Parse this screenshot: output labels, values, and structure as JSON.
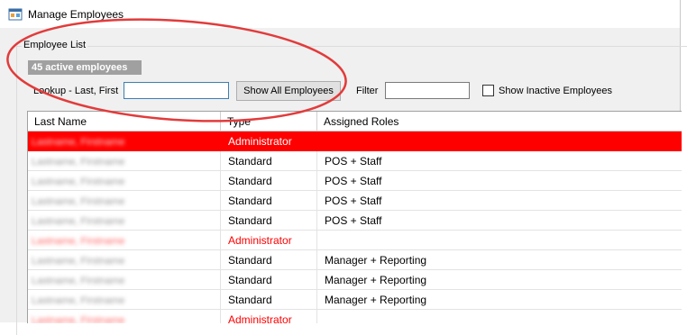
{
  "window": {
    "title": "Manage Employees"
  },
  "group": {
    "label": "Employee List",
    "count_badge": "45 active employees"
  },
  "toolbar": {
    "lookup_label": "Lookup - Last, First",
    "lookup_value": "",
    "show_all_label": "Show All Employees",
    "filter_label": "Filter",
    "filter_value": "",
    "show_inactive_label": "Show Inactive Employees",
    "show_inactive_checked": false
  },
  "grid": {
    "headers": {
      "name": "Last Name",
      "type": "Type",
      "roles": "Assigned Roles"
    },
    "rows": [
      {
        "name": "Lastname, Firstname",
        "type": "Administrator",
        "roles": ""
      },
      {
        "name": "Lastname, Firstname",
        "type": "Standard",
        "roles": "POS + Staff"
      },
      {
        "name": "Lastname, Firstname",
        "type": "Standard",
        "roles": "POS + Staff"
      },
      {
        "name": "Lastname, Firstname",
        "type": "Standard",
        "roles": "POS + Staff"
      },
      {
        "name": "Lastname, Firstname",
        "type": "Standard",
        "roles": "POS + Staff"
      },
      {
        "name": "Lastname, Firstname",
        "type": "Administrator",
        "roles": ""
      },
      {
        "name": "Lastname, Firstname",
        "type": "Standard",
        "roles": "Manager + Reporting"
      },
      {
        "name": "Lastname, Firstname",
        "type": "Standard",
        "roles": "Manager + Reporting"
      },
      {
        "name": "Lastname, Firstname",
        "type": "Standard",
        "roles": "Manager + Reporting"
      },
      {
        "name": "Lastname, Firstname",
        "type": "Administrator",
        "roles": ""
      }
    ]
  },
  "colors": {
    "selected_row": "#ff0000",
    "admin_text": "#ff0000",
    "annotation": "#e23b3b",
    "badge_bg": "#a0a0a0"
  },
  "icons": {
    "app": "app-window-icon"
  }
}
